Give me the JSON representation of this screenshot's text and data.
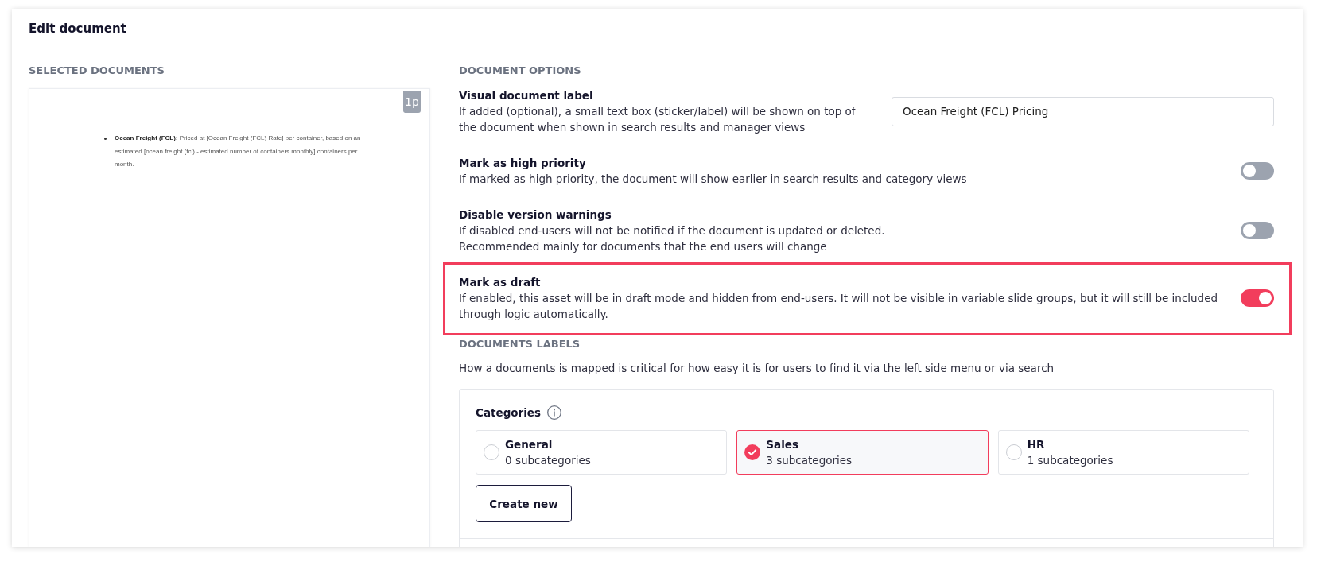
{
  "window": {
    "title": "Edit document"
  },
  "selected_documents": {
    "heading": "SELECTED DOCUMENTS",
    "page_badge": "1p",
    "preview_text": "**Ocean Freight (FCL):** Priced at [Ocean Freight (FCL) Rate] per container, based on an estimated [ocean freight (fcl) - estimated number of containers monthly] containers per month."
  },
  "document_options": {
    "heading": "DOCUMENT OPTIONS",
    "options": [
      {
        "kind": "text",
        "title": "Visual document label",
        "description": "If added (optional), a small text box (sticker/label) will be shown on top of the document when shown in search results and manager views",
        "value": "Ocean Freight (FCL) Pricing",
        "highlighted": false
      },
      {
        "kind": "toggle",
        "title": "Mark as high priority",
        "description": "If marked as high priority, the document will show earlier in search results and category views",
        "on": false,
        "highlighted": false
      },
      {
        "kind": "toggle",
        "title": "Disable version warnings",
        "description": "If disabled end-users will not be notified if the document is updated or deleted.\nRecommended mainly for documents that the end users will change",
        "on": false,
        "highlighted": false
      },
      {
        "kind": "toggle",
        "title": "Mark as draft",
        "description": "If enabled, this asset will be in draft mode and hidden from end-users. It will not be visible in variable slide groups, but it will still be included through logic automatically.",
        "on": true,
        "highlighted": true
      }
    ]
  },
  "documents_labels": {
    "heading": "DOCUMENTS LABELS",
    "description": "How a documents is mapped is critical for how easy it is for users to find it via the left side menu or via search",
    "categories": {
      "label": "Categories",
      "items": [
        {
          "name": "General",
          "count": "0 subcategories",
          "selected": false
        },
        {
          "name": "Sales",
          "count": "3 subcategories",
          "selected": true
        },
        {
          "name": "HR",
          "count": "1 subcategories",
          "selected": false
        }
      ],
      "create_button": "Create new"
    }
  }
}
